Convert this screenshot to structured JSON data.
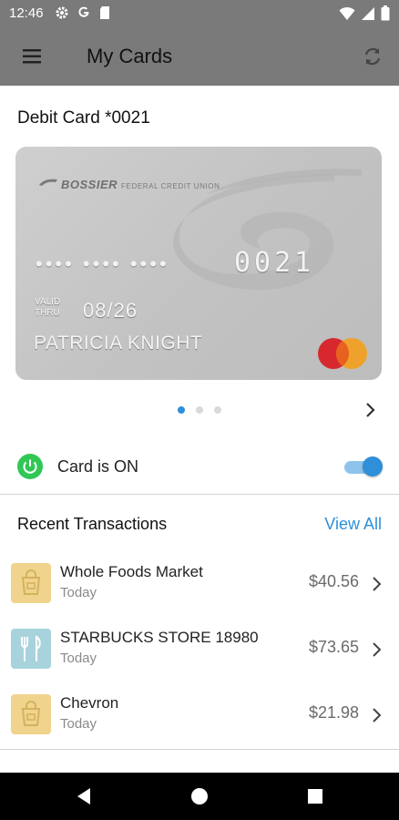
{
  "status_bar": {
    "time": "12:46",
    "left_icons": [
      "gear-icon",
      "google-icon",
      "sd-card-icon"
    ],
    "right_icons": [
      "wifi-icon",
      "signal-icon",
      "battery-icon"
    ]
  },
  "app_bar": {
    "title": "My Cards",
    "menu_icon": "hamburger-icon",
    "refresh_icon": "refresh-icon"
  },
  "card_section": {
    "title": "Debit Card *0021",
    "card": {
      "issuer_name": "BOSSIER",
      "issuer_sub": "FEDERAL CREDIT UNION",
      "masked_number": "•••• •••• ••••",
      "last4": "0021",
      "valid_label_1": "VALID",
      "valid_label_2": "THRU",
      "expiry": "08/26",
      "holder": "PATRICIA KNIGHT",
      "network": "mastercard"
    },
    "pager": {
      "count": 3,
      "active_index": 0
    }
  },
  "card_status": {
    "label": "Card is ON",
    "enabled": true,
    "colors": {
      "power": "#31c755",
      "toggle": "#2f8fd8"
    }
  },
  "transactions": {
    "heading": "Recent Transactions",
    "view_all": "View All",
    "items": [
      {
        "name": "Whole Foods Market",
        "date": "Today",
        "amount": "$40.56",
        "icon": "shopping-bag-icon"
      },
      {
        "name": "STARBUCKS STORE 18980",
        "date": "Today",
        "amount": "$73.65",
        "icon": "fork-knife-icon"
      },
      {
        "name": "Chevron",
        "date": "Today",
        "amount": "$21.98",
        "icon": "shopping-bag-icon"
      }
    ]
  },
  "nav_bar": {
    "buttons": [
      "back-icon",
      "home-icon",
      "recents-icon"
    ]
  },
  "colors": {
    "app_bar": "#7a7a7a",
    "accent": "#2f8fd8"
  }
}
